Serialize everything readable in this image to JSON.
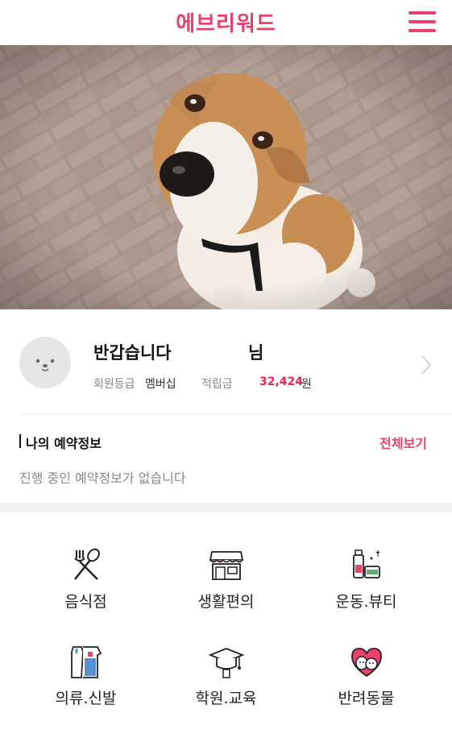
{
  "header": {
    "title": "에브리워드",
    "menu_icon": "hamburger-menu-icon"
  },
  "hero": {
    "image": "beagle-dog-photo"
  },
  "profile": {
    "greeting": "반갑습니다",
    "suffix": "님",
    "grade_label": "회원등급",
    "grade_value": "멤버십",
    "points_label": "적립금",
    "points_value": "32,424",
    "points_unit": "원",
    "accent": "#e8264f"
  },
  "reservation": {
    "title": "나의 예약정보",
    "view_all": "전체보기",
    "empty_text": "진행 중인 예약정보가 없습니다"
  },
  "categories": [
    {
      "label": "음식점",
      "icon": "fork-spoon-icon"
    },
    {
      "label": "생활편의",
      "icon": "storefront-icon"
    },
    {
      "label": "운동.뷰티",
      "icon": "cosmetics-icon"
    },
    {
      "label": "의류.신발",
      "icon": "clothing-icon"
    },
    {
      "label": "학원.교육",
      "icon": "graduation-cap-icon"
    },
    {
      "label": "반려동물",
      "icon": "pet-heart-icon"
    }
  ],
  "colors": {
    "brand": "#e8426d"
  }
}
